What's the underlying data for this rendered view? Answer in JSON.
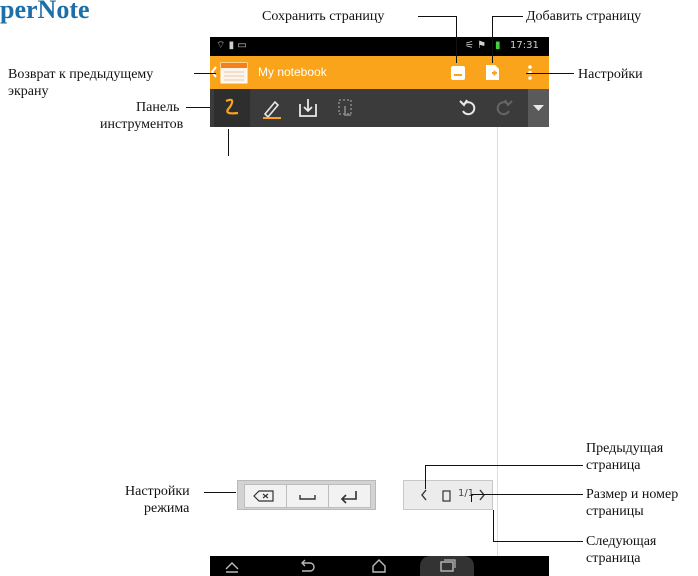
{
  "brand_title": "perNote",
  "device": {
    "status_time": "17:31",
    "notebook_title": "My notebook",
    "pager_text": "1/1"
  },
  "annotations": {
    "save_page": "Сохранить страницу",
    "add_page": "Добавить страницу",
    "back_line1": "Возврат к предыдущему",
    "back_line2": "экрану",
    "settings": "Настройки",
    "toolbar_line1": "Панель",
    "toolbar_line2": "инструментов",
    "mode_line1": "Настройки",
    "mode_line2": "режима",
    "prev_line1": "Предыдущая",
    "prev_line2": "страница",
    "size_line1": "Размер и номер",
    "size_line2": "страницы",
    "next_line1": "Следующая",
    "next_line2": "страница"
  },
  "colors": {
    "action_bar": "#f9a41b",
    "toolbar": "#3b3b3b",
    "status_bar": "#000000",
    "brand": "#1d6fa8"
  },
  "icons": [
    "back-arrow-icon",
    "notebook-icon",
    "save-icon",
    "add-page-icon",
    "overflow-menu-icon",
    "pen-icon",
    "highlighter-icon",
    "import-icon",
    "touch-icon",
    "undo-icon",
    "redo-icon",
    "dropdown-icon",
    "backspace-icon",
    "space-icon",
    "enter-icon",
    "chevron-left-icon",
    "page-size-icon",
    "chevron-right-icon",
    "nav-back-icon",
    "nav-home-icon",
    "nav-recent-icon",
    "nav-up-icon"
  ]
}
